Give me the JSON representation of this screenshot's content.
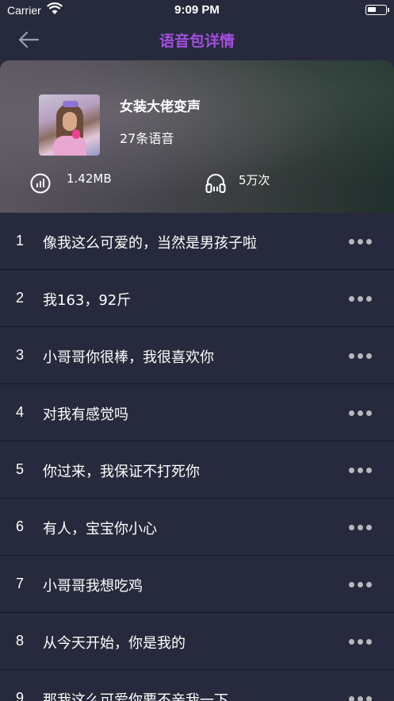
{
  "status_bar": {
    "carrier": "Carrier",
    "time": "9:09 PM"
  },
  "nav": {
    "title": "语音包详情",
    "title_color": "#a24fe0"
  },
  "pack": {
    "name": "女装大佬变声",
    "count": "27条语音",
    "size": "1.42MB",
    "plays": "5万次"
  },
  "items": [
    {
      "num": "1",
      "text": "像我这么可爱的，当然是男孩子啦"
    },
    {
      "num": "2",
      "text": "我163，92斤"
    },
    {
      "num": "3",
      "text": "小哥哥你很棒，我很喜欢你"
    },
    {
      "num": "4",
      "text": "对我有感觉吗"
    },
    {
      "num": "5",
      "text": "你过来，我保证不打死你"
    },
    {
      "num": "6",
      "text": "有人，宝宝你小心"
    },
    {
      "num": "7",
      "text": "小哥哥我想吃鸡"
    },
    {
      "num": "8",
      "text": "从今天开始，你是我的"
    },
    {
      "num": "9",
      "text": "那我这么可爱你要不亲我一下"
    }
  ],
  "icons": {
    "back": "arrow-left-icon",
    "size": "equalizer-icon",
    "plays": "headphones-icon",
    "more": "more-dots-icon"
  }
}
